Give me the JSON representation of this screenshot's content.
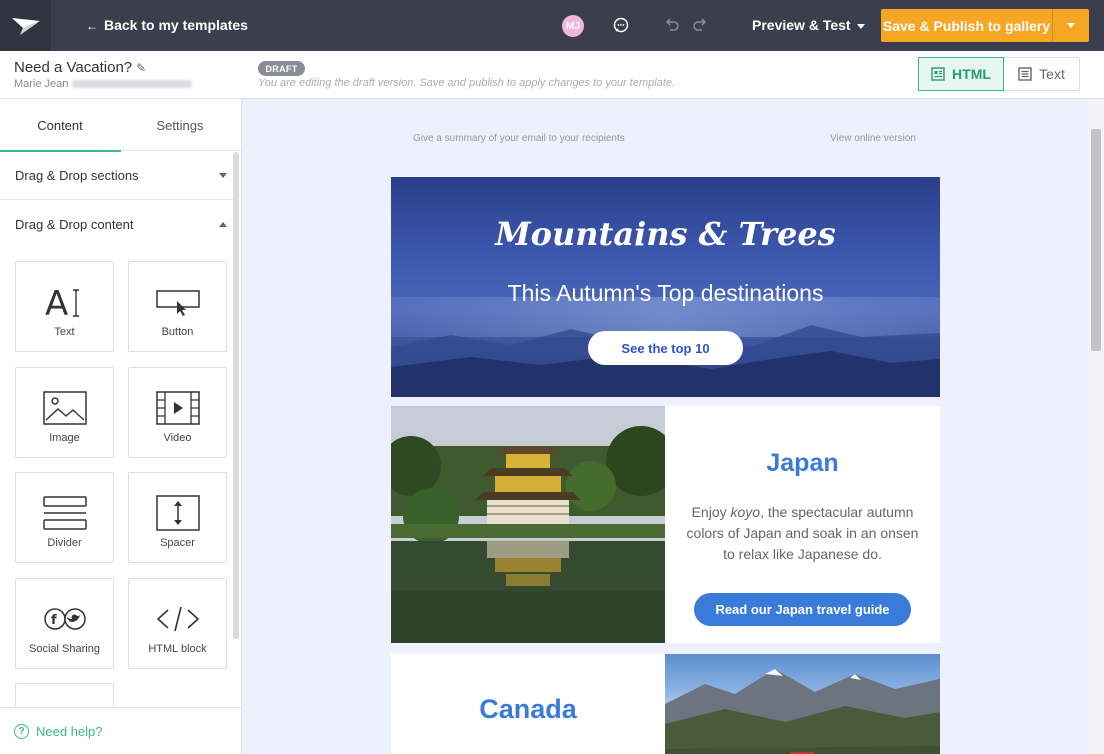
{
  "topbar": {
    "back_label": "Back to my templates",
    "avatar_initials": "MJ",
    "preview_label": "Preview & Test",
    "publish_label": "Save & Publish to gallery",
    "accent_color": "#f5a623",
    "bar_color": "#3b3f4d"
  },
  "template": {
    "name": "Need a Vacation?",
    "owner": "Marie Jean",
    "draft_badge": "DRAFT",
    "draft_note": "You are editing the draft version. Save and publish to apply changes to your template."
  },
  "mode": {
    "html_label": "HTML",
    "text_label": "Text",
    "active": "HTML"
  },
  "sidebar": {
    "tabs": [
      {
        "label": "Content"
      },
      {
        "label": "Settings"
      }
    ],
    "sections": [
      {
        "label": "Drag & Drop sections",
        "state": "collapsed"
      },
      {
        "label": "Drag & Drop content",
        "state": "expanded"
      }
    ],
    "blocks": [
      {
        "label": "Text",
        "icon": "text-icon"
      },
      {
        "label": "Button",
        "icon": "button-icon"
      },
      {
        "label": "Image",
        "icon": "image-icon"
      },
      {
        "label": "Video",
        "icon": "video-icon"
      },
      {
        "label": "Divider",
        "icon": "divider-icon"
      },
      {
        "label": "Spacer",
        "icon": "spacer-icon"
      },
      {
        "label": "Social Sharing",
        "icon": "social-icon"
      },
      {
        "label": "HTML block",
        "icon": "code-icon"
      }
    ],
    "help_label": "Need help?",
    "accent_color": "#3bb792"
  },
  "email": {
    "preheader": "Give a summary of your email to your recipients",
    "view_online": "View online version",
    "hero": {
      "title": "Mountains & Trees",
      "subtitle": "This Autumn's Top destinations",
      "button": "See the top 10"
    },
    "japan": {
      "title": "Japan",
      "body_prefix": "Enjoy ",
      "body_italic": "koyo",
      "body_suffix": ", the spectacular autumn colors of Japan and soak in an onsen to relax like Japanese do.",
      "button": "Read our Japan travel guide"
    },
    "canada": {
      "title": "Canada"
    },
    "link_color": "#3a7bd9"
  }
}
